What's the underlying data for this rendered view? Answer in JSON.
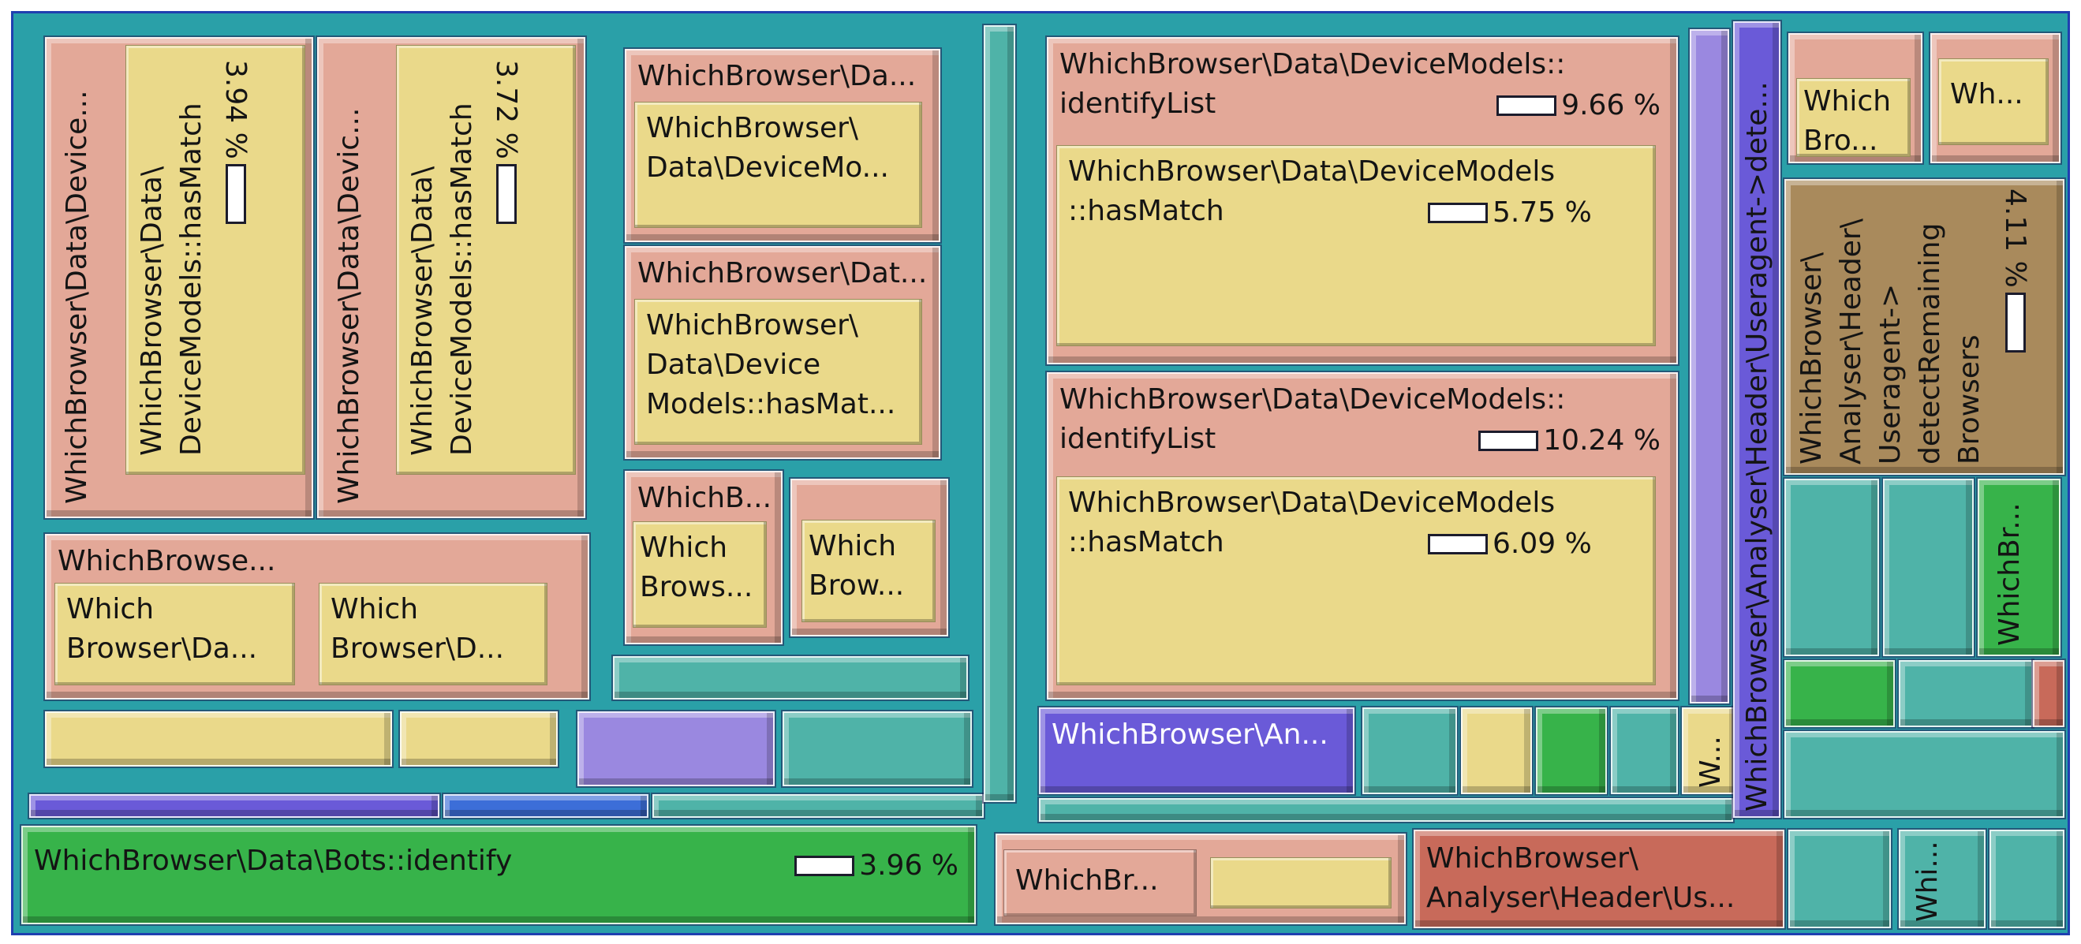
{
  "tiles": {
    "t1": {
      "label": "WhichBrowser\\Data\\Device..."
    },
    "t1a": {
      "label": "WhichBrowser\\Data\\\nDeviceModels::hasMatch",
      "pct": "3.94 %"
    },
    "t2": {
      "label": "WhichBrowser\\Data\\Devic..."
    },
    "t2a": {
      "label": "WhichBrowser\\Data\\\nDeviceModels::hasMatch",
      "pct": "3.72 %"
    },
    "t3": {
      "label": "WhichBrowser\\Da..."
    },
    "t3a": {
      "label": "WhichBrowser\\\nData\\DeviceMo..."
    },
    "t4": {
      "label": "WhichBrowser\\Dat..."
    },
    "t4a": {
      "label": "WhichBrowser\\\nData\\Device\nModels::hasMat..."
    },
    "t5": {
      "label": "WhichBrowse..."
    },
    "t5a": {
      "label": "Which\nBrowser\\Da..."
    },
    "t5b": {
      "label": "Which\nBrowser\\D..."
    },
    "t6": {
      "label": "WhichB..."
    },
    "t6a": {
      "label": "Which\nBrows..."
    },
    "t6b": {
      "label": "Which\nBrow..."
    },
    "t7": {
      "label": "WhichBrowser\\Data\\DeviceModels::\nidentifyList",
      "pct": "9.66 %"
    },
    "t7a": {
      "label": "WhichBrowser\\Data\\DeviceModels\n::hasMatch",
      "pct": "5.75 %"
    },
    "t8": {
      "label": "WhichBrowser\\Data\\DeviceModels::\nidentifyList",
      "pct": "10.24 %"
    },
    "t8a": {
      "label": "WhichBrowser\\Data\\DeviceModels\n::hasMatch",
      "pct": "6.09 %"
    },
    "t9": {
      "label": "WhichBrowser\\Analyser\\Header\\Useragent->dete..."
    },
    "t10": {
      "label": "Which\nBro..."
    },
    "t11": {
      "label": "Wh..."
    },
    "t12": {
      "label": "WhichBrowser\\\nAnalyser\\Header\\\nUseragent->\ndetectRemaining\nBrowsers",
      "pct": "4.11 %"
    },
    "t13": {
      "label": "WhichBr..."
    },
    "t14": {
      "label": "WhichBrowser\\An..."
    },
    "t15": {
      "label": "W..."
    },
    "t16": {
      "label": "WhichBrowser\\Data\\Bots::identify",
      "pct": "3.96 %"
    },
    "t17": {
      "label": "WhichBr..."
    },
    "t18": {
      "label": "WhichBrowser\\\nAnalyser\\Header\\Us..."
    },
    "t19": {
      "label": "Whi..."
    }
  }
}
